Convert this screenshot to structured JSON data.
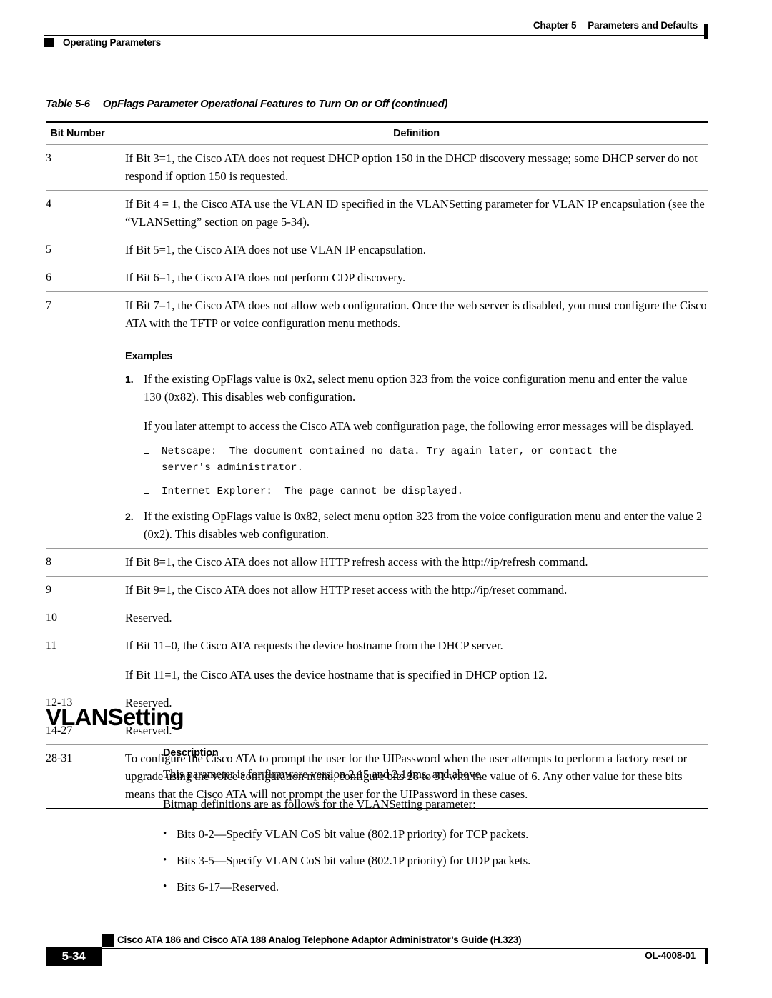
{
  "header": {
    "chapter": "Chapter 5",
    "chapter_title": "Parameters and Defaults",
    "left_label": "Operating Parameters"
  },
  "table": {
    "title_number": "Table 5-6",
    "title_text": "OpFlags Parameter Operational Features to Turn On or Off  (continued)",
    "columns": [
      "Bit Number",
      "Definition"
    ],
    "rows": [
      {
        "bit": "3",
        "paragraphs": [
          "If Bit 3=1, the Cisco ATA does not request DHCP option 150 in the DHCP discovery message; some DHCP server do not respond if option 150 is requested."
        ]
      },
      {
        "bit": "4",
        "paragraphs": [
          "If Bit 4 = 1, the Cisco ATA use the VLAN ID specified in the VLANSetting parameter for VLAN IP encapsulation (see the “VLANSetting” section on page 5-34)."
        ]
      },
      {
        "bit": "5",
        "paragraphs": [
          "If Bit 5=1, the Cisco ATA does not use VLAN IP encapsulation."
        ]
      },
      {
        "bit": "6",
        "paragraphs": [
          "If Bit 6=1, the Cisco ATA does not perform CDP discovery."
        ]
      },
      {
        "bit": "7",
        "paragraphs": [
          "If Bit 7=1, the Cisco ATA does not allow web configuration. Once the web server is disabled, you must configure the Cisco ATA with the TFTP or voice configuration menu methods."
        ],
        "examples_heading": "Examples",
        "example_1_marker": "1.",
        "example_1_text": "If the existing OpFlags value is 0x2, select menu option 323 from the voice configuration menu and enter the value 130 (0x82). This disables web configuration.",
        "example_1_followup": "If you later attempt to access the Cisco ATA web configuration page, the following error messages will be displayed.",
        "dash_marker": "–",
        "error_1": "Netscape:  The document contained no data. Try again later, or contact the\nserver's administrator.",
        "error_2": "Internet Explorer:  The page cannot be displayed.",
        "example_2_marker": "2.",
        "example_2_text": "If the existing OpFlags value is 0x82, select menu option 323 from the voice configuration menu and enter the value 2 (0x2). This disables web configuration."
      },
      {
        "bit": "8",
        "paragraphs": [
          "If Bit 8=1, the Cisco ATA does not allow HTTP refresh access with the http://ip/refresh command."
        ]
      },
      {
        "bit": "9",
        "paragraphs": [
          "If Bit 9=1, the Cisco ATA does not allow HTTP reset access with the http://ip/reset command."
        ]
      },
      {
        "bit": "10",
        "paragraphs": [
          "Reserved."
        ]
      },
      {
        "bit": "11",
        "paragraphs": [
          "If Bit 11=0, the Cisco ATA requests the device hostname from the DHCP server.",
          "If Bit 11=1, the Cisco ATA uses the device hostname that is specified in DHCP option 12."
        ]
      },
      {
        "bit": "12-13",
        "paragraphs": [
          "Reserved."
        ]
      },
      {
        "bit": "14-27",
        "paragraphs": [
          "Reserved."
        ]
      },
      {
        "bit": "28-31",
        "paragraphs": [
          "To configure the Cisco ATA to prompt the user for the UIPassword when the user attempts to perform a factory reset or upgrade using the voice configuration menu, configure bits 28 to 31 with the value of 6. Any other value for these bits means that the Cisco ATA will not prompt the user for the UIPassword in these cases."
        ]
      }
    ]
  },
  "section": {
    "heading": "VLANSetting",
    "sub_heading": "Description",
    "para_1": "This parameter is for firmware version 2.15 and 2.14ms, and above.",
    "para_2": "Bitmap definitions are as follows for the VLANSetting parameter:",
    "bullet_dot": "•",
    "bullets": [
      "Bits 0-2—Specify VLAN CoS bit value (802.1P priority) for TCP packets.",
      "Bits 3-5—Specify VLAN CoS bit value (802.1P priority) for UDP packets.",
      "Bits 6-17—Reserved."
    ]
  },
  "footer": {
    "page_number": "5-34",
    "guide_title": "Cisco ATA 186 and Cisco ATA 188 Analog Telephone Adaptor Administrator’s Guide (H.323)",
    "doc_id": "OL-4008-01"
  }
}
